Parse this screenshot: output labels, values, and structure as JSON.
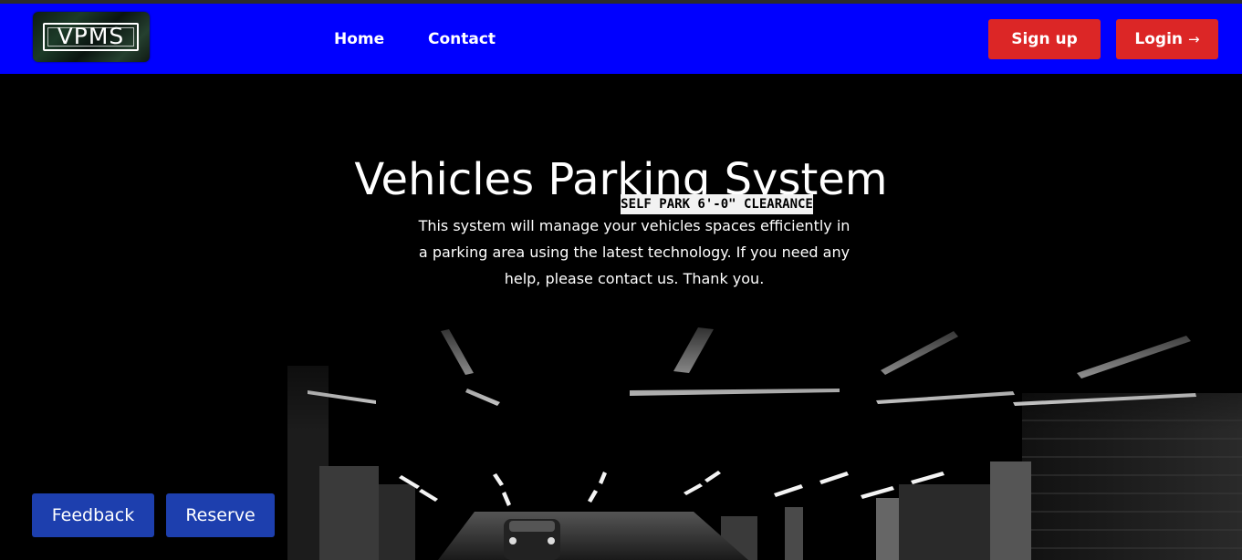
{
  "brand": {
    "logo_text": "VPMS"
  },
  "nav": {
    "home_label": "Home",
    "contact_label": "Contact",
    "signup_label": "Sign up",
    "login_label": "Login",
    "login_icon": "arrow-right-icon"
  },
  "hero": {
    "title": "Vehicles Parking System",
    "description": "This system will manage your vehicles spaces efficiently in a parking area using the latest technology. If you need any help, please contact us. Thank you.",
    "sign_text": "SELF PARK 6'-0\" CLEARANCE"
  },
  "actions": {
    "feedback_label": "Feedback",
    "reserve_label": "Reserve"
  },
  "colors": {
    "navbar": "#0000ff",
    "primary_red": "#dc2626",
    "action_blue": "#1d3fae",
    "background": "#000000"
  }
}
